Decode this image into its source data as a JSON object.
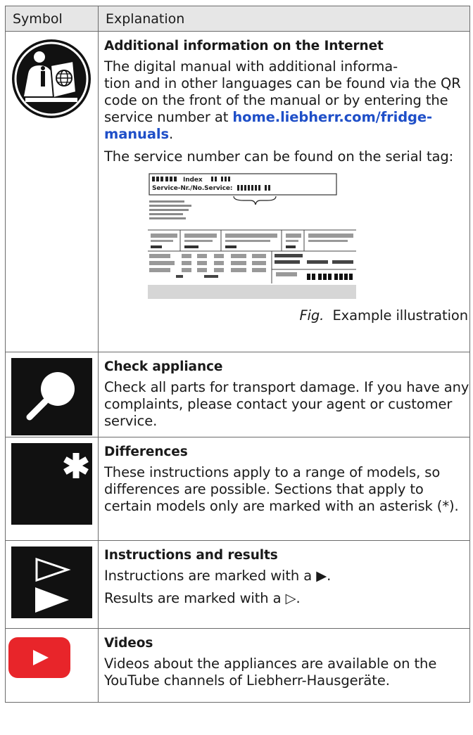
{
  "header": {
    "col_symbol": "Symbol",
    "col_explanation": "Explanation"
  },
  "rows": {
    "info": {
      "title": "Additional information on the Internet",
      "p1_a": "The digital manual with additional informa-\ntion and in other languages can be found via the QR code on the front of the manual or by entering the service number at ",
      "link": "home.liebherr.com/fridge-manuals",
      "p1_b": ".",
      "p2": "The service number can be found on the serial tag:",
      "tag_index": "Index",
      "tag_service": "Service-Nr./No.Service:",
      "fig_label": "Fig.",
      "fig_caption": "Example illustration"
    },
    "check": {
      "title": "Check appliance",
      "text": "Check all parts for transport damage. If you have any complaints, please contact your agent or customer service."
    },
    "diff": {
      "title": "Differences",
      "text": "These instructions apply to a range of models, so differences are possible. Sections that apply to certain models only are marked with an asterisk (*)."
    },
    "inst": {
      "title": "Instructions and results",
      "line1_a": "Instructions are marked with a ",
      "line1_sym": "▶",
      "line1_b": ".",
      "line2_a": "Results are marked with a ",
      "line2_sym": "▷",
      "line2_b": "."
    },
    "video": {
      "title": "Videos",
      "text": "Videos about the appliances are available on the YouTube channels of Liebherr-Hausgeräte."
    }
  },
  "icons": [
    "info-manual-icon",
    "magnifier-icon",
    "asterisk-icon",
    "instruction-triangles-icon",
    "youtube-icon"
  ],
  "colors": {
    "link": "#1f4fc8",
    "youtube": "#e8252a",
    "header_bg": "#e6e6e6"
  }
}
